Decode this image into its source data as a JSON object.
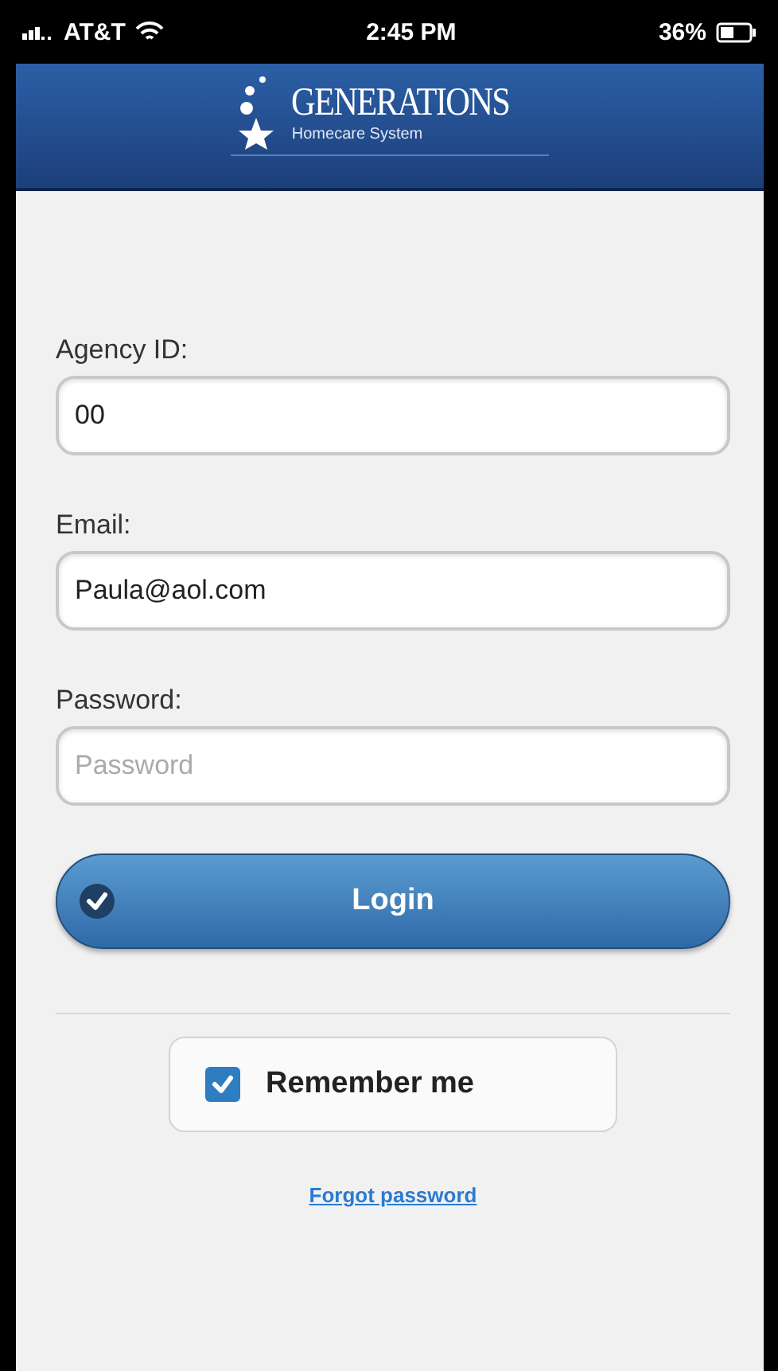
{
  "status_bar": {
    "carrier": "AT&T",
    "time": "2:45 PM",
    "battery": "36%"
  },
  "header": {
    "logo_title": "GENERATIONS",
    "logo_subtitle": "Homecare System"
  },
  "fields": [
    {
      "label": "Agency ID:",
      "value": "00"
    },
    {
      "label": "Email:",
      "value": "Paula@aol.com"
    },
    {
      "label": "Password:",
      "placeholder": "Password"
    }
  ],
  "login_button": "Login",
  "remember": {
    "label": "Remember me",
    "checked": true
  },
  "forgot_link": "Forgot password"
}
